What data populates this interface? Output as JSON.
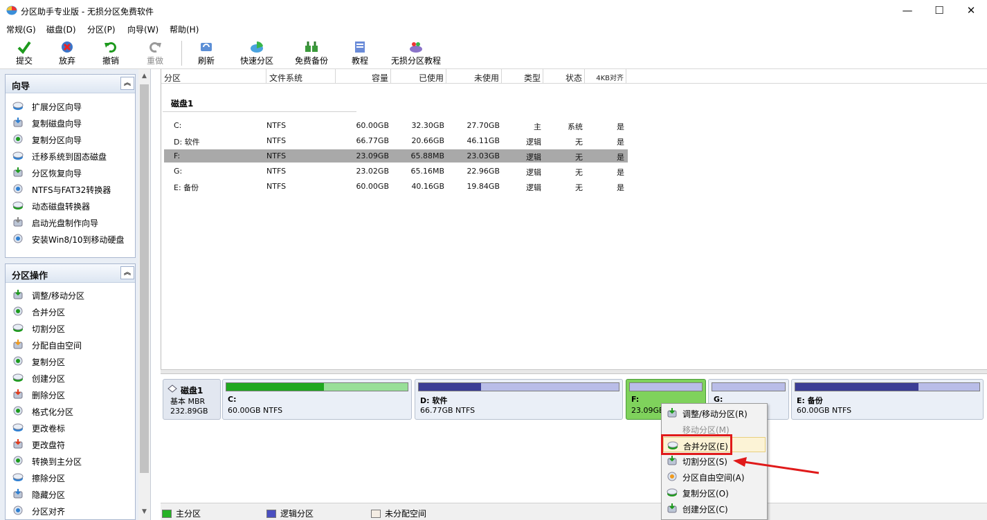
{
  "window": {
    "title": "分区助手专业版 - 无损分区免费软件",
    "min": "—",
    "max": "☐",
    "close": "✕"
  },
  "menu": [
    "常规(G)",
    "磁盘(D)",
    "分区(P)",
    "向导(W)",
    "帮助(H)"
  ],
  "toolbar": {
    "commit": "提交",
    "discard": "放弃",
    "undo": "撤销",
    "redo": "重做",
    "refresh": "刷新",
    "quick": "快速分区",
    "backup": "免费备份",
    "tutorial": "教程",
    "lossless": "无损分区教程"
  },
  "wizard": {
    "title": "向导",
    "items": [
      "扩展分区向导",
      "复制磁盘向导",
      "复制分区向导",
      "迁移系统到固态磁盘",
      "分区恢复向导",
      "NTFS与FAT32转换器",
      "动态磁盘转换器",
      "启动光盘制作向导",
      "安装Win8/10到移动硬盘"
    ]
  },
  "ops": {
    "title": "分区操作",
    "items": [
      "调整/移动分区",
      "合并分区",
      "切割分区",
      "分配自由空间",
      "复制分区",
      "创建分区",
      "删除分区",
      "格式化分区",
      "更改卷标",
      "更改盘符",
      "转换到主分区",
      "擦除分区",
      "隐藏分区",
      "分区对齐"
    ]
  },
  "table": {
    "headers": [
      "分区",
      "文件系统",
      "容量",
      "已使用",
      "未使用",
      "类型",
      "状态",
      "4KB对齐"
    ],
    "disk_label": "磁盘1",
    "rows": [
      [
        "C:",
        "NTFS",
        "60.00GB",
        "32.30GB",
        "27.70GB",
        "主",
        "系统",
        "是"
      ],
      [
        "D: 软件",
        "NTFS",
        "66.77GB",
        "20.66GB",
        "46.11GB",
        "逻辑",
        "无",
        "是"
      ],
      [
        "F:",
        "NTFS",
        "23.09GB",
        "65.88MB",
        "23.03GB",
        "逻辑",
        "无",
        "是"
      ],
      [
        "G:",
        "NTFS",
        "23.02GB",
        "65.16MB",
        "22.96GB",
        "逻辑",
        "无",
        "是"
      ],
      [
        "E: 备份",
        "NTFS",
        "60.00GB",
        "40.16GB",
        "19.84GB",
        "逻辑",
        "无",
        "是"
      ]
    ],
    "selected_row": 2
  },
  "diskmap": {
    "disk": {
      "name": "磁盘1",
      "type": "基本 MBR",
      "size": "232.89GB"
    },
    "parts": [
      {
        "name": "C:",
        "info": "60.00GB NTFS",
        "used": 0.54,
        "kind": "primary"
      },
      {
        "name": "D: 软件",
        "info": "66.77GB NTFS",
        "used": 0.31,
        "kind": "logical"
      },
      {
        "name": "F:",
        "info": "23.09GB",
        "used": 0.0,
        "kind": "selected"
      },
      {
        "name": "G:",
        "info": "",
        "used": 0.0,
        "kind": "logical"
      },
      {
        "name": "E: 备份",
        "info": "60.00GB NTFS",
        "used": 0.67,
        "kind": "logical"
      }
    ]
  },
  "legend": {
    "primary": "主分区",
    "logical": "逻辑分区",
    "unalloc": "未分配空间"
  },
  "context_menu": [
    "调整/移动分区(R)",
    "移动分区(M)",
    "合并分区(E)",
    "切割分区(S)",
    "分区自由空间(A)",
    "复制分区(O)",
    "创建分区(C)"
  ],
  "colors": {
    "primary": "#1fa81f",
    "primary_light": "#98df98",
    "logical": "#3b3d96",
    "logical_light": "#b9bde8",
    "selected_bg": "#7fd25c",
    "highlight": "#e01a1a"
  }
}
